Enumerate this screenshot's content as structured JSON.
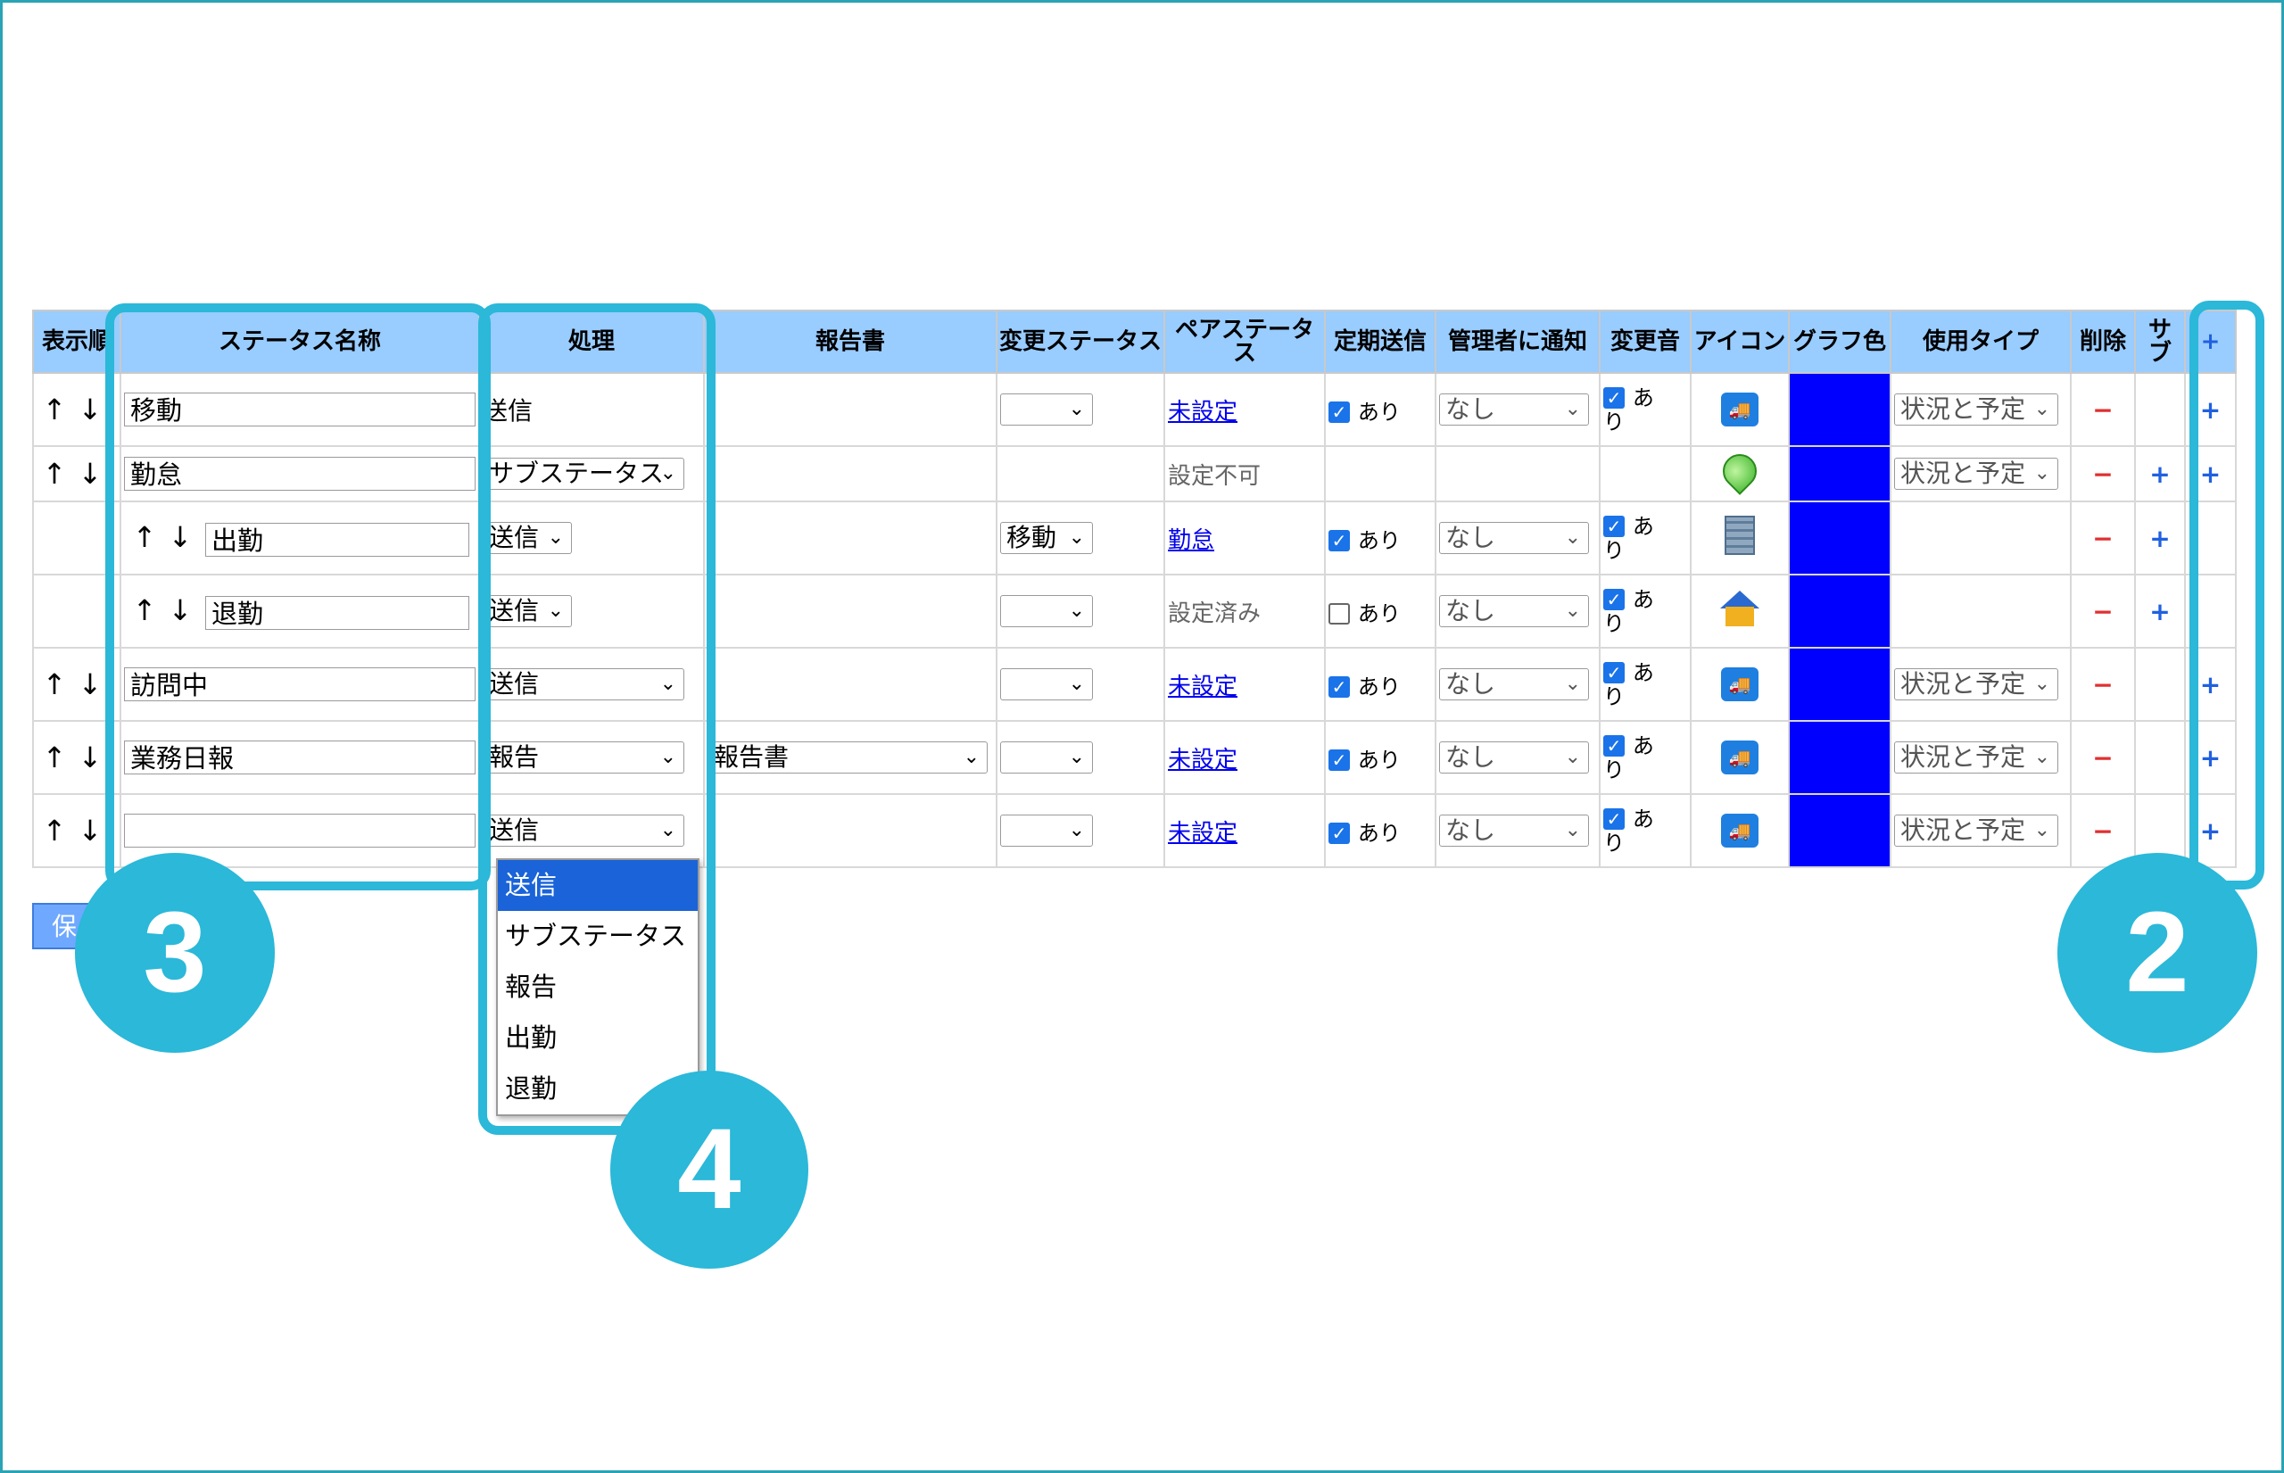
{
  "headers": {
    "order": "表示順",
    "name": "ステータス名称",
    "process": "処理",
    "report": "報告書",
    "change_status": "変更ステータス",
    "pair_status": "ペアステータス",
    "periodic": "定期送信",
    "notify_admin": "管理者に通知",
    "sound": "変更音",
    "icon": "アイコン",
    "graph_color": "グラフ色",
    "use_type": "使用タイプ",
    "delete": "削除",
    "sub": "サブ",
    "add": "+"
  },
  "arrows": {
    "up": "↑",
    "down": "↓"
  },
  "rows": [
    {
      "name": "移動",
      "process": "送信",
      "pair": "未設定",
      "periodic_label": "あり",
      "notify": "なし",
      "sound_a": "あ",
      "sound_b": "り",
      "use_type": "状況と予定",
      "minus": "−",
      "plus": "+"
    },
    {
      "name": "勤怠",
      "process": "サブステータス",
      "pair": "設定不可",
      "use_type": "状況と予定",
      "minus": "−",
      "sub_plus": "+",
      "plus": "+"
    },
    {
      "name": "出勤",
      "process": "送信",
      "change": "移動",
      "pair": "勤怠",
      "periodic_label": "あり",
      "notify": "なし",
      "sound_a": "あ",
      "sound_b": "り",
      "minus": "−",
      "sub_plus": "+"
    },
    {
      "name": "退勤",
      "process": "送信",
      "pair": "設定済み",
      "periodic_label": "あり",
      "notify": "なし",
      "sound_a": "あ",
      "sound_b": "り",
      "minus": "−",
      "sub_plus": "+"
    },
    {
      "name": "訪問中",
      "process": "送信",
      "pair": "未設定",
      "periodic_label": "あり",
      "notify": "なし",
      "sound_a": "あ",
      "sound_b": "り",
      "use_type": "状況と予定",
      "minus": "−",
      "plus": "+"
    },
    {
      "name": "業務日報",
      "process": "報告",
      "report": "報告書",
      "pair": "未設定",
      "periodic_label": "あり",
      "notify": "なし",
      "sound_a": "あ",
      "sound_b": "り",
      "use_type": "状況と予定",
      "minus": "−",
      "plus": "+"
    },
    {
      "name": "",
      "process": "送信",
      "pair": "未設定",
      "periodic_label": "あり",
      "notify": "なし",
      "sound_a": "あ",
      "sound_b": "り",
      "use_type": "状況と予定",
      "minus": "−",
      "plus": "+"
    }
  ],
  "dropdown_options": [
    "送信",
    "サブステータス",
    "報告",
    "出勤",
    "退勤"
  ],
  "save_button": "保",
  "badges": {
    "b2": "2",
    "b3": "3",
    "b4": "4"
  },
  "colors": {
    "header_bg": "#99ccff",
    "graph_color": "#0000ff",
    "highlight": "#2bb8d9",
    "link": "#0000ee"
  },
  "icons": [
    "truck-icon",
    "pin-icon",
    "building-icon",
    "house-icon"
  ]
}
